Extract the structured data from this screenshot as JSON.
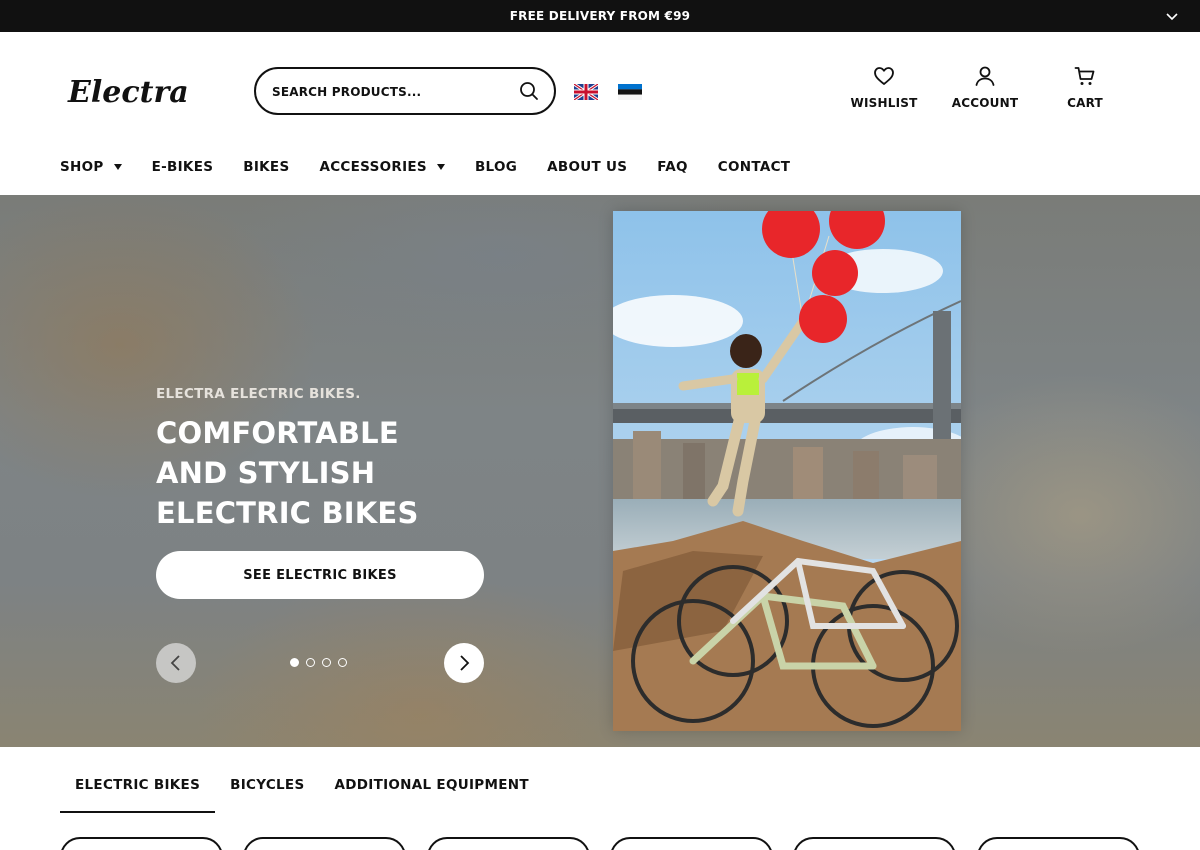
{
  "announcement": {
    "text": "FREE DELIVERY FROM €99"
  },
  "header": {
    "logo_text": "Electra",
    "search": {
      "placeholder": "SEARCH PRODUCTS..."
    },
    "languages": [
      "English",
      "Estonian"
    ],
    "actions": {
      "wishlist": "WISHLIST",
      "account": "ACCOUNT",
      "cart": "CART"
    }
  },
  "nav": {
    "items": [
      {
        "label": "SHOP",
        "dropdown": true
      },
      {
        "label": "E-BIKES",
        "dropdown": false
      },
      {
        "label": "BIKES",
        "dropdown": false
      },
      {
        "label": "ACCESSORIES",
        "dropdown": true
      },
      {
        "label": "BLOG",
        "dropdown": false
      },
      {
        "label": "ABOUT US",
        "dropdown": false
      },
      {
        "label": "FAQ",
        "dropdown": false
      },
      {
        "label": "CONTACT",
        "dropdown": false
      }
    ]
  },
  "hero": {
    "eyebrow": "ELECTRA ELECTRIC BIKES.",
    "title": "COMFORTABLE AND STYLISH ELECTRIC BIKES",
    "cta": "SEE ELECTRIC BIKES",
    "slide_count": 4,
    "active_slide": 1
  },
  "tabs": {
    "items": [
      "ELECTRIC BIKES",
      "BICYCLES",
      "ADDITIONAL EQUIPMENT"
    ],
    "active": 0
  },
  "category_pill_count": 6,
  "colors": {
    "announcement_bg": "#111111",
    "text": "#111111",
    "background": "#ffffff"
  },
  "icons": [
    "chevron-down-icon",
    "search-icon",
    "heart-icon",
    "user-icon",
    "cart-icon",
    "chevron-left-icon",
    "chevron-right-icon"
  ]
}
